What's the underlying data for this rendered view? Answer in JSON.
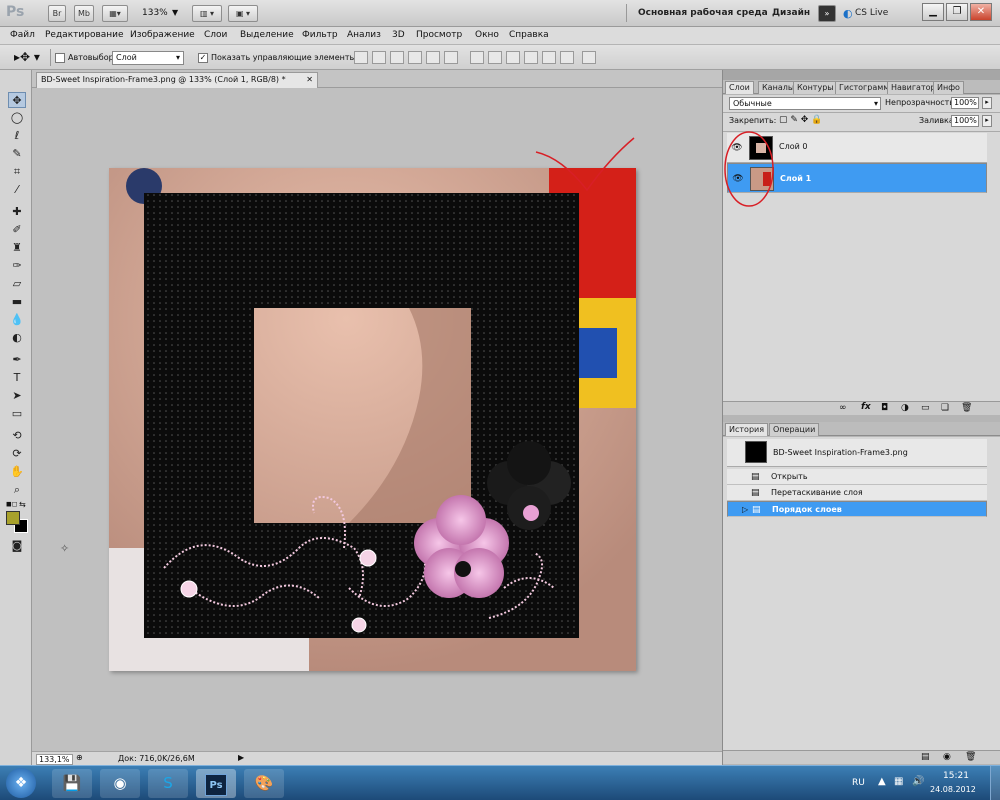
{
  "app": {
    "logo": "Ps",
    "br_label": "Br",
    "mb_label": "Mb",
    "zoom": "133%",
    "workspace": "Основная рабочая среда",
    "workspace2": "Дизайн",
    "cs_live": "CS Live",
    "colors": {
      "accent": "#3f9bf2",
      "annotation": "#d81f26"
    }
  },
  "menu": {
    "items": [
      "Файл",
      "Редактирование",
      "Изображение",
      "Слои",
      "Выделение",
      "Фильтр",
      "Анализ",
      "3D",
      "Просмотр",
      "Окно",
      "Справка"
    ]
  },
  "options": {
    "autoselect_label": "Автовыбор:",
    "autoselect_value": "Слой",
    "show_controls_label": "Показать управляющие элементы",
    "show_controls_checked": "✓"
  },
  "document": {
    "tab_title": "BD-Sweet Inspiration-Frame3.png @ 133% (Слой 1, RGB/8) *",
    "zoom": "133,1%",
    "doc_info": "Док: 716,0K/26,6M"
  },
  "layers_panel": {
    "tabs": [
      "Слои",
      "Каналы",
      "Контуры",
      "Гистограмма",
      "Навигатор",
      "Инфо"
    ],
    "blend_mode": "Обычные",
    "opacity_label": "Непрозрачность:",
    "opacity_value": "100%",
    "lock_label": "Закрепить:",
    "fill_label": "Заливка:",
    "fill_value": "100%",
    "layers": [
      {
        "name": "Слой 0",
        "selected": false
      },
      {
        "name": "Слой 1",
        "selected": true
      }
    ]
  },
  "history_panel": {
    "tabs": [
      "История",
      "Операции"
    ],
    "snapshot": "BD-Sweet Inspiration-Frame3.png",
    "items": [
      {
        "name": "Открыть",
        "selected": false
      },
      {
        "name": "Перетаскивание слоя",
        "selected": false
      },
      {
        "name": "Порядок слоев",
        "selected": true
      }
    ]
  },
  "taskbar": {
    "lang": "RU",
    "time": "15:21",
    "date": "24.08.2012",
    "ps_label": "Ps"
  }
}
